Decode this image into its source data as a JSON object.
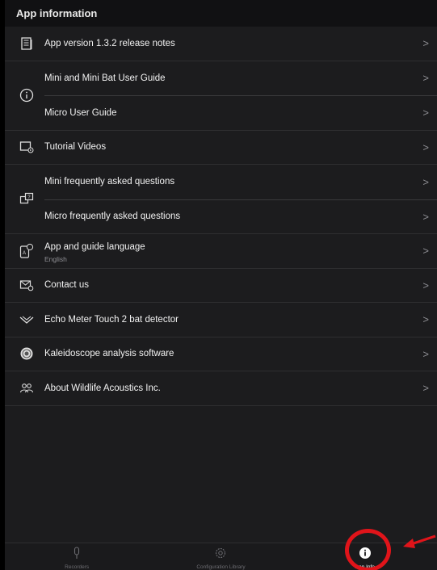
{
  "section_title": "App information",
  "rows": {
    "release_notes": "App version 1.3.2 release notes",
    "mini_guide": "Mini and Mini Bat User Guide",
    "micro_guide": "Micro User Guide",
    "tutorials": "Tutorial Videos",
    "mini_faq": "Mini frequently asked questions",
    "micro_faq": "Micro frequently asked questions",
    "language": "App and guide language",
    "language_value": "English",
    "contact": "Contact us",
    "echo_meter": "Echo Meter Touch 2 bat detector",
    "kaleidoscope": "Kaleidoscope analysis software",
    "about": "About Wildlife Acoustics Inc."
  },
  "chevron": ">",
  "tabs": {
    "recorders": "Recorders",
    "config_library": "Configuration Library",
    "app_info": "App Info"
  },
  "colors": {
    "annotation": "#e0141a",
    "background": "#1c1c1e"
  }
}
